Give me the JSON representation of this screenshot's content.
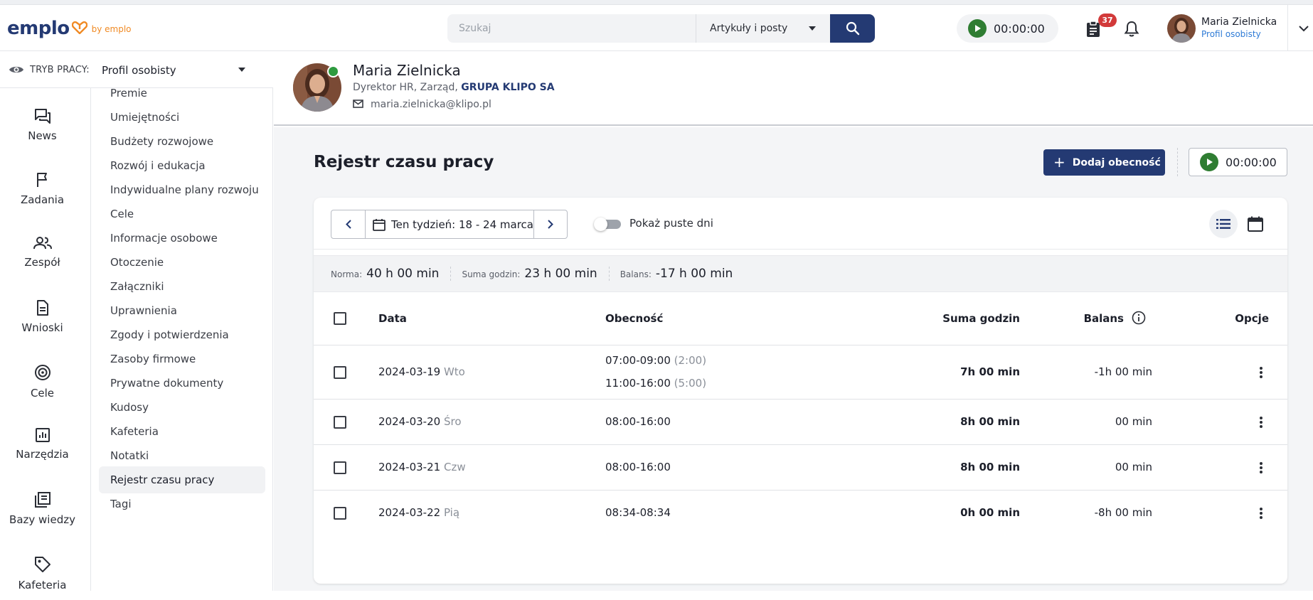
{
  "brand": {
    "logo_text": "emplo",
    "by_text": "by emplo",
    "colors": {
      "primary": "#243a73",
      "accent": "#f08a24",
      "success": "#2f7d32",
      "badge": "#d23a3a",
      "link": "#2e7bd6"
    }
  },
  "search": {
    "placeholder": "Szukaj",
    "scope": "Artykuły i posty"
  },
  "header": {
    "timer": "00:00:00",
    "tasks_badge": "37",
    "user": {
      "name": "Maria Zielnicka",
      "profile_link": "Profil osobisty"
    }
  },
  "work_mode": {
    "label": "TRYB PRACY:",
    "value": "Profil osobisty"
  },
  "rail": [
    {
      "label": "News",
      "icon": "chat-icon"
    },
    {
      "label": "Zadania",
      "icon": "flag-icon"
    },
    {
      "label": "Zespół",
      "icon": "team-icon"
    },
    {
      "label": "Wnioski",
      "icon": "document-icon"
    },
    {
      "label": "Cele",
      "icon": "target-icon"
    },
    {
      "label": "Narzędzia",
      "icon": "chart-icon"
    },
    {
      "label": "Bazy wiedzy",
      "icon": "books-icon"
    },
    {
      "label": "Kafeteria",
      "icon": "tag-icon"
    }
  ],
  "submenu": [
    "Premie",
    "Umiejętności",
    "Budżety rozwojowe",
    "Rozwój i edukacja",
    "Indywidualne plany rozwoju",
    "Cele",
    "Informacje osobowe",
    "Otoczenie",
    "Załączniki",
    "Uprawnienia",
    "Zgody i potwierdzenia",
    "Zasoby firmowe",
    "Prywatne dokumenty",
    "Kudosy",
    "Kafeteria",
    "Notatki",
    "Rejestr czasu pracy",
    "Tagi"
  ],
  "submenu_active": "Rejestr czasu pracy",
  "profile": {
    "name": "Maria Zielnicka",
    "role": "Dyrektor HR, Zarząd, ",
    "company": "GRUPA KLIPO SA",
    "email": "maria.zielnicka@klipo.pl",
    "status": "online"
  },
  "page": {
    "title": "Rejestr czasu pracy",
    "add_button": "Dodaj obecność",
    "timer": "00:00:00",
    "week_label": "Ten tydzień: 18 - 24 marca",
    "toggle_label": "Pokaż puste dni",
    "toggle_on": false
  },
  "summary": {
    "norma_label": "Norma:",
    "norma_value": "40 h 00 min",
    "suma_label": "Suma godzin:",
    "suma_value": "23 h 00 min",
    "balans_label": "Balans:",
    "balans_value": "-17 h 00 min"
  },
  "table": {
    "columns": {
      "date": "Data",
      "presence": "Obecność",
      "total": "Suma godzin",
      "balance": "Balans",
      "options": "Opcje"
    },
    "rows": [
      {
        "date": "2024-03-19",
        "day": "Wto",
        "presence": [
          {
            "range": "07:00-09:00",
            "dur": "(2:00)"
          },
          {
            "range": "11:00-16:00",
            "dur": "(5:00)"
          }
        ],
        "total": "7h 00 min",
        "balance": "-1h 00 min"
      },
      {
        "date": "2024-03-20",
        "day": "Śro",
        "presence": [
          {
            "range": "08:00-16:00",
            "dur": ""
          }
        ],
        "total": "8h 00 min",
        "balance": "00 min"
      },
      {
        "date": "2024-03-21",
        "day": "Czw",
        "presence": [
          {
            "range": "08:00-16:00",
            "dur": ""
          }
        ],
        "total": "8h 00 min",
        "balance": "00 min"
      },
      {
        "date": "2024-03-22",
        "day": "Pią",
        "presence": [
          {
            "range": "08:34-08:34",
            "dur": ""
          }
        ],
        "total": "0h 00 min",
        "balance": "-8h 00 min"
      }
    ]
  }
}
